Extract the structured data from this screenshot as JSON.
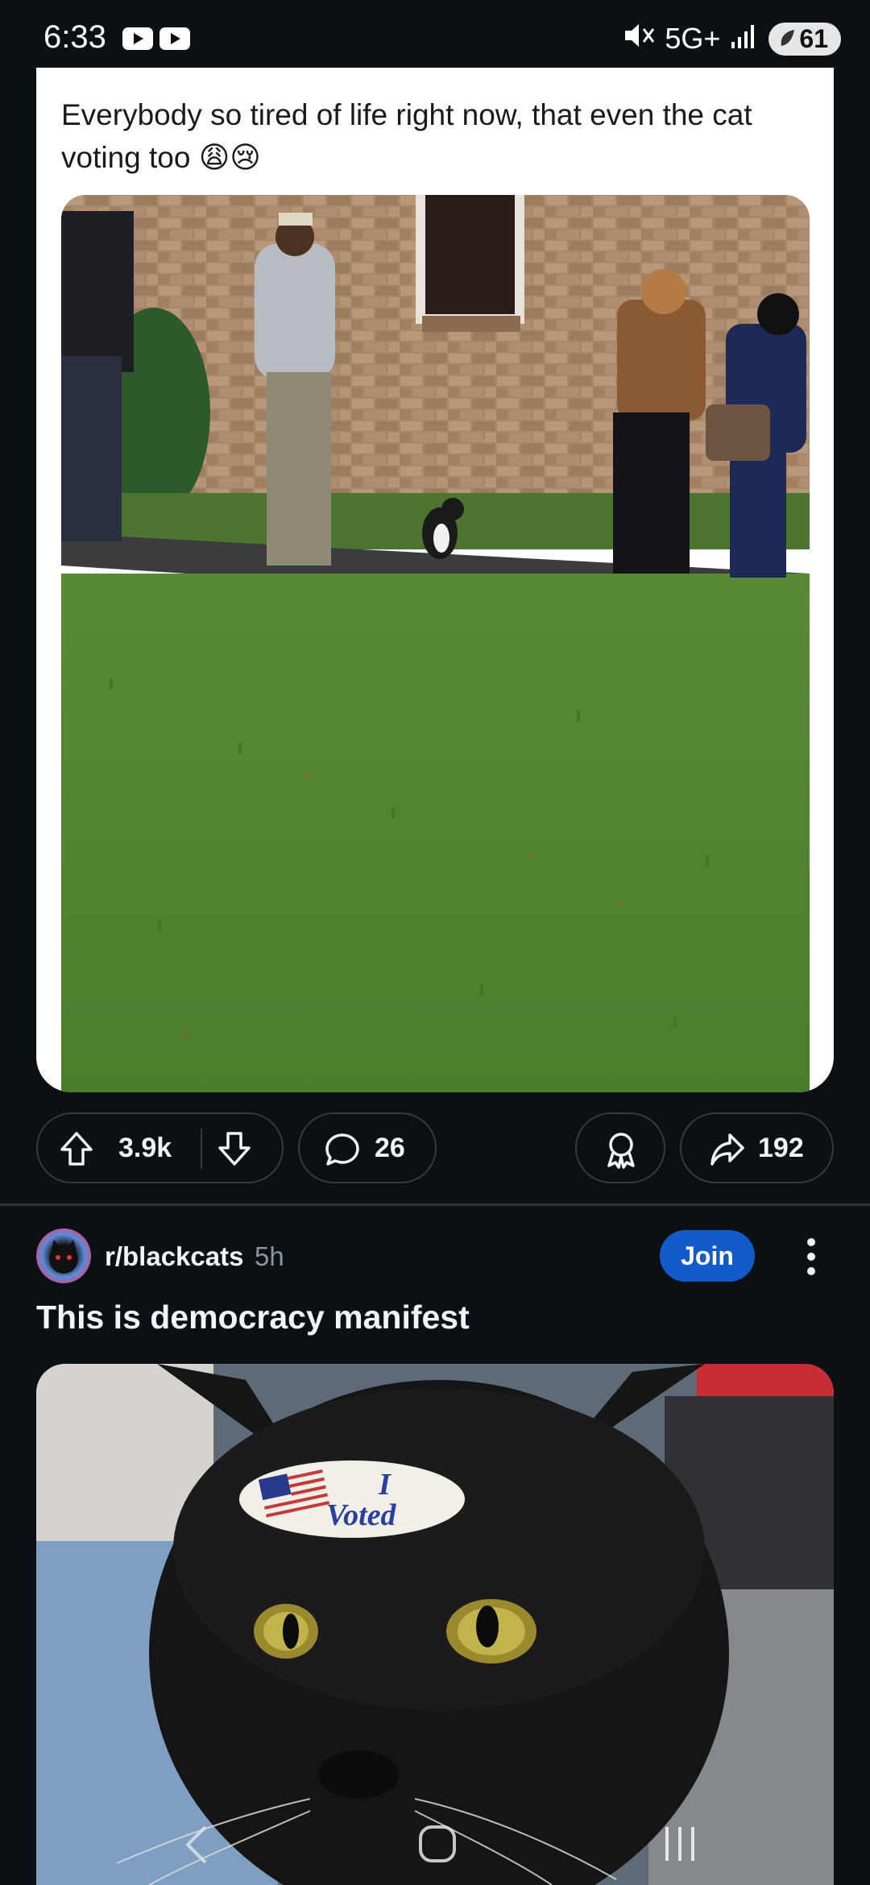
{
  "status_bar": {
    "time": "6:33",
    "network": "5G+",
    "battery": "61",
    "icons": [
      "youtube-icon",
      "youtube-icon",
      "mute-icon",
      "signal-icon",
      "battery-icon"
    ]
  },
  "post1": {
    "text": "Everybody so tired of life right now, that even the cat voting too 😩😢",
    "image_alt": "cat-in-voting-line-image",
    "upvotes": "3.9k",
    "comments": "26",
    "shares": "192"
  },
  "post2": {
    "subreddit": "r/blackcats",
    "age": "5h",
    "join_label": "Join",
    "title": "This is democracy manifest",
    "sticker_line1": "I",
    "sticker_line2": "Voted"
  },
  "colors": {
    "background": "#0b1014",
    "card": "#ffffff",
    "join": "#115bca",
    "pill_border": "#343a3e",
    "muted_text": "#8d969c"
  }
}
